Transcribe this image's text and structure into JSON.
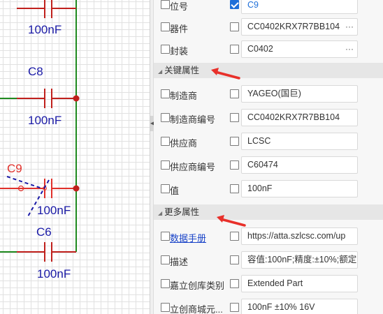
{
  "schematic": {
    "top_cap_value": "100nF",
    "c8": {
      "ref": "C8",
      "value": "100nF"
    },
    "c9": {
      "ref": "C9",
      "value": "100nF"
    },
    "c6": {
      "ref": "C6",
      "value": "100nF"
    }
  },
  "panel": {
    "rows_top": [
      {
        "label": "位号",
        "value": "C9",
        "checked": true
      },
      {
        "label": "器件",
        "value": "CC0402KRX7R7BB104",
        "more": "···"
      },
      {
        "label": "封装",
        "value": "C0402",
        "more": "···"
      }
    ],
    "section_key": {
      "title": "关键属性"
    },
    "rows_key": [
      {
        "label": "制造商",
        "value": "YAGEO(国巨)"
      },
      {
        "label": "制造商编号",
        "value": "CC0402KRX7R7BB104"
      },
      {
        "label": "供应商",
        "value": "LCSC"
      },
      {
        "label": "供应商编号",
        "value": "C60474"
      },
      {
        "label": "值",
        "value": "100nF"
      }
    ],
    "section_more": {
      "title": "更多属性"
    },
    "rows_more": [
      {
        "label": "数据手册",
        "value": "https://atta.szlcsc.com/up"
      },
      {
        "label": "描述",
        "value": "容值:100nF;精度:±10%;额定"
      },
      {
        "label": "嘉立创库类别",
        "value": "Extended Part"
      },
      {
        "label": "立创商城元...",
        "value": "100nF ±10% 16V"
      }
    ]
  },
  "colors": {
    "wire_green": "#1f8a1f",
    "wire_red": "#c0201c",
    "annotation_red": "#e8302a",
    "checkbox_blue": "#1e6fd9"
  }
}
